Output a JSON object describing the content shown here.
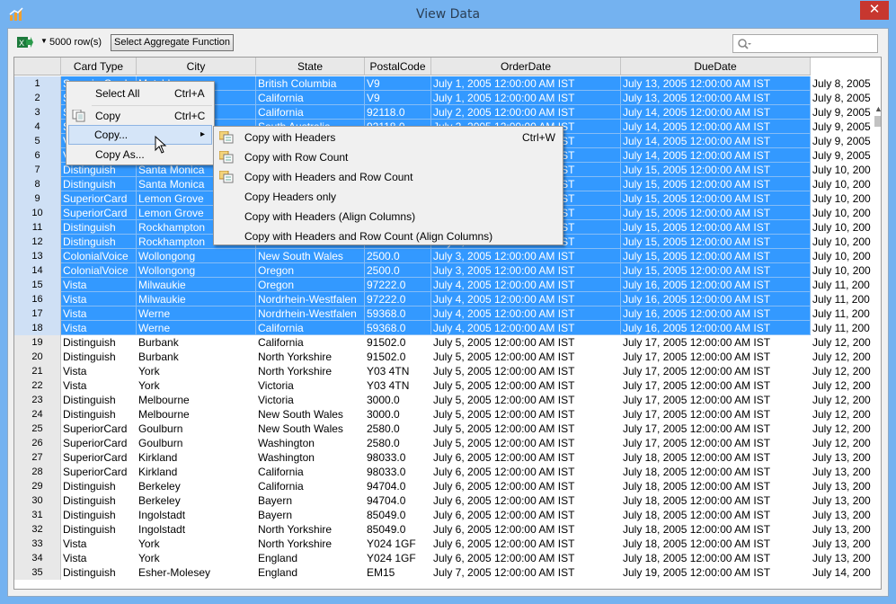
{
  "window": {
    "title": "View Data",
    "close_label": "✕"
  },
  "toolbar": {
    "row_count": "5000 row(s)",
    "aggregate_button": "Select Aggregate Function",
    "dropdown_arrow": "▼"
  },
  "search": {
    "placeholder": ""
  },
  "icons": [
    "app-chart-icon",
    "excel-export-icon",
    "search-icon",
    "copy-icon",
    "copy-headers-icon"
  ],
  "columns": [
    {
      "label": "Card Type"
    },
    {
      "label": "City"
    },
    {
      "label": "State"
    },
    {
      "label": "PostalCode"
    },
    {
      "label": "OrderDate"
    },
    {
      "label": "DueDate"
    },
    {
      "label": ""
    }
  ],
  "rows": [
    {
      "n": "1",
      "sel": true,
      "c": [
        "SuperiorCard",
        "Matchbox",
        "British Columbia",
        "V9",
        "July 1, 2005 12:00:00 AM IST",
        "July 13, 2005 12:00:00 AM IST",
        "July 8, 2005"
      ]
    },
    {
      "n": "2",
      "sel": true,
      "c": [
        "SuperiorCard",
        "Matchbox",
        "California",
        "V9",
        "July 1, 2005 12:00:00 AM IST",
        "July 13, 2005 12:00:00 AM IST",
        "July 8, 2005"
      ]
    },
    {
      "n": "3",
      "sel": true,
      "c": [
        "SuperiorCard",
        "",
        "California",
        "92118.0",
        "July 2, 2005 12:00:00 AM IST",
        "July 14, 2005 12:00:00 AM IST",
        "July 9, 2005"
      ]
    },
    {
      "n": "4",
      "sel": true,
      "c": [
        "SuperiorCard",
        "",
        "South Australia",
        "92118.0",
        "July 2, 2005 12:00:00 AM IST",
        "July 14, 2005 12:00:00 AM IST",
        "July 9, 2005"
      ]
    },
    {
      "n": "5",
      "sel": true,
      "c": [
        "Vista",
        "",
        "",
        "",
        "July 2, 2005 12:00:00 AM IST",
        "July 14, 2005 12:00:00 AM IST",
        "July 9, 2005"
      ]
    },
    {
      "n": "6",
      "sel": true,
      "c": [
        "Vista",
        "",
        "",
        "",
        "July 2, 2005 12:00:00 AM IST",
        "July 14, 2005 12:00:00 AM IST",
        "July 9, 2005"
      ]
    },
    {
      "n": "7",
      "sel": true,
      "c": [
        "Distinguish",
        "Santa Monica",
        "",
        "",
        "July 3, 2005 12:00:00 AM IST",
        "July 15, 2005 12:00:00 AM IST",
        "July 10, 200"
      ]
    },
    {
      "n": "8",
      "sel": true,
      "c": [
        "Distinguish",
        "Santa Monica",
        "",
        "",
        "July 3, 2005 12:00:00 AM IST",
        "July 15, 2005 12:00:00 AM IST",
        "July 10, 200"
      ]
    },
    {
      "n": "9",
      "sel": true,
      "c": [
        "SuperiorCard",
        "Lemon Grove",
        "",
        "",
        "July 3, 2005 12:00:00 AM IST",
        "July 15, 2005 12:00:00 AM IST",
        "July 10, 200"
      ]
    },
    {
      "n": "10",
      "sel": true,
      "c": [
        "SuperiorCard",
        "Lemon Grove",
        "",
        "",
        "July 3, 2005 12:00:00 AM IST",
        "July 15, 2005 12:00:00 AM IST",
        "July 10, 200"
      ]
    },
    {
      "n": "11",
      "sel": true,
      "c": [
        "Distinguish",
        "Rockhampton",
        "",
        "",
        "July 3, 2005 12:00:00 AM IST",
        "July 15, 2005 12:00:00 AM IST",
        "July 10, 200"
      ]
    },
    {
      "n": "12",
      "sel": true,
      "c": [
        "Distinguish",
        "Rockhampton",
        "",
        "",
        "July 3, 2005 12:00:00 AM IST",
        "July 15, 2005 12:00:00 AM IST",
        "July 10, 200"
      ]
    },
    {
      "n": "13",
      "sel": true,
      "c": [
        "ColonialVoice",
        "Wollongong",
        "New South Wales",
        "2500.0",
        "July 3, 2005 12:00:00 AM IST",
        "July 15, 2005 12:00:00 AM IST",
        "July 10, 200"
      ]
    },
    {
      "n": "14",
      "sel": true,
      "c": [
        "ColonialVoice",
        "Wollongong",
        "Oregon",
        "2500.0",
        "July 3, 2005 12:00:00 AM IST",
        "July 15, 2005 12:00:00 AM IST",
        "July 10, 200"
      ]
    },
    {
      "n": "15",
      "sel": true,
      "c": [
        "Vista",
        "Milwaukie",
        "Oregon",
        "97222.0",
        "July 4, 2005 12:00:00 AM IST",
        "July 16, 2005 12:00:00 AM IST",
        "July 11, 200"
      ]
    },
    {
      "n": "16",
      "sel": true,
      "c": [
        "Vista",
        "Milwaukie",
        "Nordrhein-Westfalen",
        "97222.0",
        "July 4, 2005 12:00:00 AM IST",
        "July 16, 2005 12:00:00 AM IST",
        "July 11, 200"
      ]
    },
    {
      "n": "17",
      "sel": true,
      "c": [
        "Vista",
        "Werne",
        "Nordrhein-Westfalen",
        "59368.0",
        "July 4, 2005 12:00:00 AM IST",
        "July 16, 2005 12:00:00 AM IST",
        "July 11, 200"
      ]
    },
    {
      "n": "18",
      "sel": true,
      "c": [
        "Vista",
        "Werne",
        "California",
        "59368.0",
        "July 4, 2005 12:00:00 AM IST",
        "July 16, 2005 12:00:00 AM IST",
        "July 11, 200"
      ]
    },
    {
      "n": "19",
      "sel": false,
      "c": [
        "Distinguish",
        "Burbank",
        "California",
        "91502.0",
        "July 5, 2005 12:00:00 AM IST",
        "July 17, 2005 12:00:00 AM IST",
        "July 12, 200"
      ]
    },
    {
      "n": "20",
      "sel": false,
      "c": [
        "Distinguish",
        "Burbank",
        "North Yorkshire",
        "91502.0",
        "July 5, 2005 12:00:00 AM IST",
        "July 17, 2005 12:00:00 AM IST",
        "July 12, 200"
      ]
    },
    {
      "n": "21",
      "sel": false,
      "c": [
        "Vista",
        "York",
        "North Yorkshire",
        "Y03 4TN",
        "July 5, 2005 12:00:00 AM IST",
        "July 17, 2005 12:00:00 AM IST",
        "July 12, 200"
      ]
    },
    {
      "n": "22",
      "sel": false,
      "c": [
        "Vista",
        "York",
        "Victoria",
        "Y03 4TN",
        "July 5, 2005 12:00:00 AM IST",
        "July 17, 2005 12:00:00 AM IST",
        "July 12, 200"
      ]
    },
    {
      "n": "23",
      "sel": false,
      "c": [
        "Distinguish",
        "Melbourne",
        "Victoria",
        "3000.0",
        "July 5, 2005 12:00:00 AM IST",
        "July 17, 2005 12:00:00 AM IST",
        "July 12, 200"
      ]
    },
    {
      "n": "24",
      "sel": false,
      "c": [
        "Distinguish",
        "Melbourne",
        "New South Wales",
        "3000.0",
        "July 5, 2005 12:00:00 AM IST",
        "July 17, 2005 12:00:00 AM IST",
        "July 12, 200"
      ]
    },
    {
      "n": "25",
      "sel": false,
      "c": [
        "SuperiorCard",
        "Goulburn",
        "New South Wales",
        "2580.0",
        "July 5, 2005 12:00:00 AM IST",
        "July 17, 2005 12:00:00 AM IST",
        "July 12, 200"
      ]
    },
    {
      "n": "26",
      "sel": false,
      "c": [
        "SuperiorCard",
        "Goulburn",
        "Washington",
        "2580.0",
        "July 5, 2005 12:00:00 AM IST",
        "July 17, 2005 12:00:00 AM IST",
        "July 12, 200"
      ]
    },
    {
      "n": "27",
      "sel": false,
      "c": [
        "SuperiorCard",
        "Kirkland",
        "Washington",
        "98033.0",
        "July 6, 2005 12:00:00 AM IST",
        "July 18, 2005 12:00:00 AM IST",
        "July 13, 200"
      ]
    },
    {
      "n": "28",
      "sel": false,
      "c": [
        "SuperiorCard",
        "Kirkland",
        "California",
        "98033.0",
        "July 6, 2005 12:00:00 AM IST",
        "July 18, 2005 12:00:00 AM IST",
        "July 13, 200"
      ]
    },
    {
      "n": "29",
      "sel": false,
      "c": [
        "Distinguish",
        "Berkeley",
        "California",
        "94704.0",
        "July 6, 2005 12:00:00 AM IST",
        "July 18, 2005 12:00:00 AM IST",
        "July 13, 200"
      ]
    },
    {
      "n": "30",
      "sel": false,
      "c": [
        "Distinguish",
        "Berkeley",
        "Bayern",
        "94704.0",
        "July 6, 2005 12:00:00 AM IST",
        "July 18, 2005 12:00:00 AM IST",
        "July 13, 200"
      ]
    },
    {
      "n": "31",
      "sel": false,
      "c": [
        "Distinguish",
        "Ingolstadt",
        "Bayern",
        "85049.0",
        "July 6, 2005 12:00:00 AM IST",
        "July 18, 2005 12:00:00 AM IST",
        "July 13, 200"
      ]
    },
    {
      "n": "32",
      "sel": false,
      "c": [
        "Distinguish",
        "Ingolstadt",
        "North Yorkshire",
        "85049.0",
        "July 6, 2005 12:00:00 AM IST",
        "July 18, 2005 12:00:00 AM IST",
        "July 13, 200"
      ]
    },
    {
      "n": "33",
      "sel": false,
      "c": [
        "Vista",
        "York",
        "North Yorkshire",
        "Y024 1GF",
        "July 6, 2005 12:00:00 AM IST",
        "July 18, 2005 12:00:00 AM IST",
        "July 13, 200"
      ]
    },
    {
      "n": "34",
      "sel": false,
      "c": [
        "Vista",
        "York",
        "England",
        "Y024 1GF",
        "July 6, 2005 12:00:00 AM IST",
        "July 18, 2005 12:00:00 AM IST",
        "July 13, 200"
      ]
    },
    {
      "n": "35",
      "sel": false,
      "c": [
        "Distinguish",
        "Esher-Molesey",
        "England",
        "EM15",
        "July 7, 2005 12:00:00 AM IST",
        "July 19, 2005 12:00:00 AM IST",
        "July 14, 200"
      ]
    }
  ],
  "context_menu": {
    "select_all": {
      "label": "Select All",
      "shortcut": "Ctrl+A"
    },
    "copy": {
      "label": "Copy",
      "shortcut": "Ctrl+C"
    },
    "copy_sub": {
      "label": "Copy...",
      "arrow": "▸"
    },
    "copy_as": {
      "label": "Copy As..."
    }
  },
  "submenu": [
    {
      "label": "Copy with Headers",
      "shortcut": "Ctrl+W",
      "icon": "copy-headers-icon"
    },
    {
      "label": "Copy with Row Count",
      "shortcut": "",
      "icon": "copy-headers-icon"
    },
    {
      "label": "Copy with Headers and Row Count",
      "shortcut": "",
      "icon": "copy-headers-icon"
    },
    {
      "label": "Copy Headers only",
      "shortcut": "",
      "icon": ""
    },
    {
      "label": "Copy with Headers (Align Columns)",
      "shortcut": "",
      "icon": ""
    },
    {
      "label": "Copy with Headers and Row Count (Align Columns)",
      "shortcut": "",
      "icon": ""
    }
  ],
  "scroll": {
    "up": "▲",
    "down": "▼",
    "left": "◀",
    "right": "▶"
  },
  "colors": {
    "selection": "#3399ff",
    "titlebar": "#74b2f0",
    "close": "#c7372f"
  }
}
